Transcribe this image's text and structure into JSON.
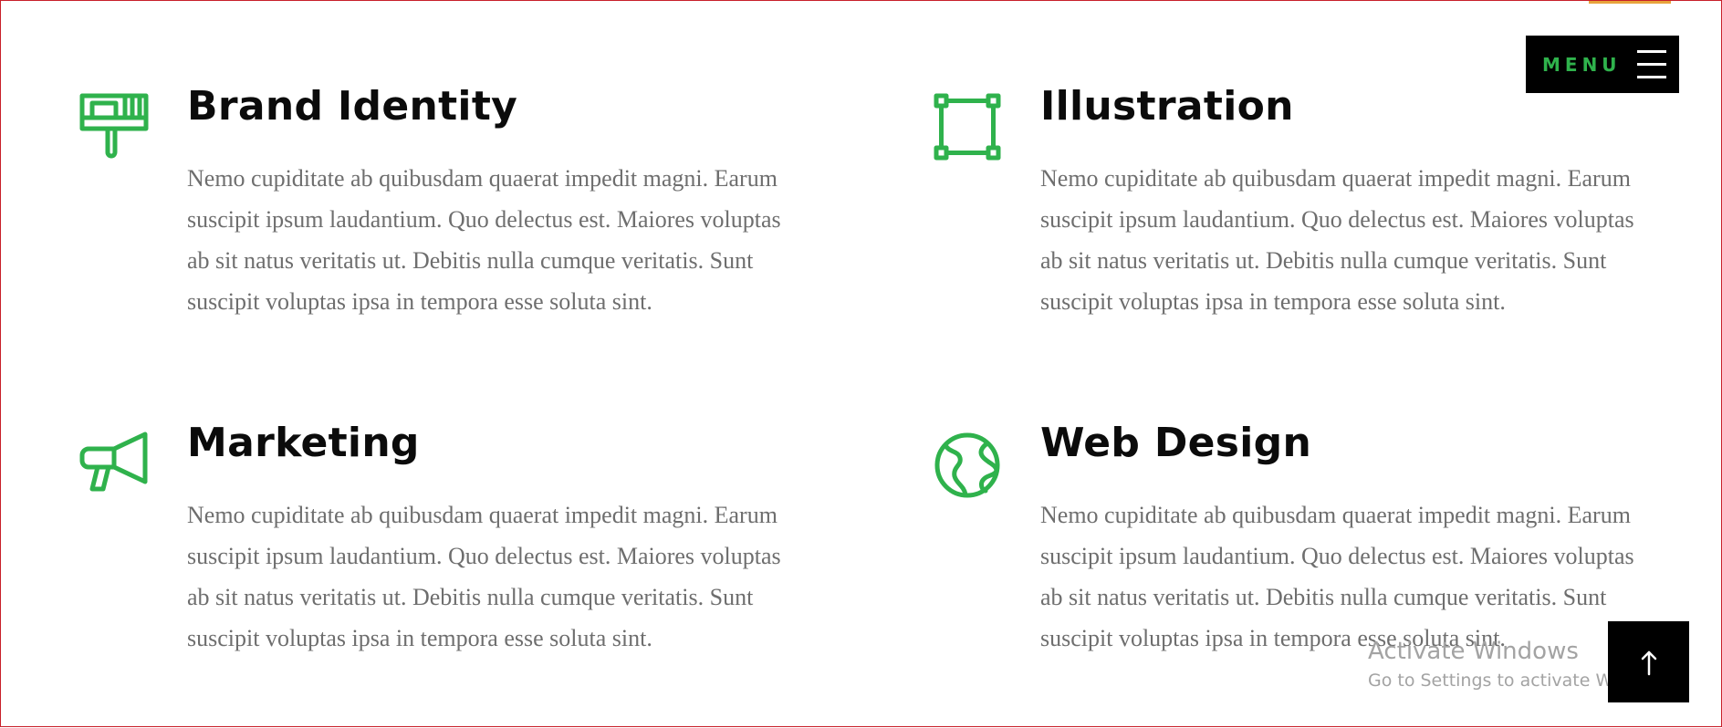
{
  "header": {
    "menu_label": "MENU"
  },
  "services": [
    {
      "title": "Brand Identity",
      "icon": "paint-brush-icon",
      "text": "Nemo cupiditate ab quibusdam quaerat impedit magni. Earum suscipit ipsum laudantium. Quo delectus est. Maiores voluptas ab sit natus veritatis ut. Debitis nulla cumque veritatis. Sunt suscipit voluptas ipsa in tempora esse soluta sint."
    },
    {
      "title": "Illustration",
      "icon": "vector-square-icon",
      "text": "Nemo cupiditate ab quibusdam quaerat impedit magni. Earum suscipit ipsum laudantium. Quo delectus est. Maiores voluptas ab sit natus veritatis ut. Debitis nulla cumque veritatis. Sunt suscipit voluptas ipsa in tempora esse soluta sint."
    },
    {
      "title": "Marketing",
      "icon": "megaphone-icon",
      "text": "Nemo cupiditate ab quibusdam quaerat impedit magni. Earum suscipit ipsum laudantium. Quo delectus est. Maiores voluptas ab sit natus veritatis ut. Debitis nulla cumque veritatis. Sunt suscipit voluptas ipsa in tempora esse soluta sint."
    },
    {
      "title": "Web Design",
      "icon": "globe-icon",
      "text": "Nemo cupiditate ab quibusdam quaerat impedit magni. Earum suscipit ipsum laudantium. Quo delectus est. Maiores voluptas ab sit natus veritatis ut. Debitis nulla cumque veritatis. Sunt suscipit voluptas ipsa in tempora esse soluta sint."
    }
  ],
  "watermark": {
    "title": "Activate Windows",
    "subtitle": "Go to Settings to activate Windows."
  },
  "colors": {
    "accent": "#2fb24c",
    "heading": "#0b0b0b",
    "body_text": "#6e6e6e",
    "button_bg": "#000000"
  }
}
